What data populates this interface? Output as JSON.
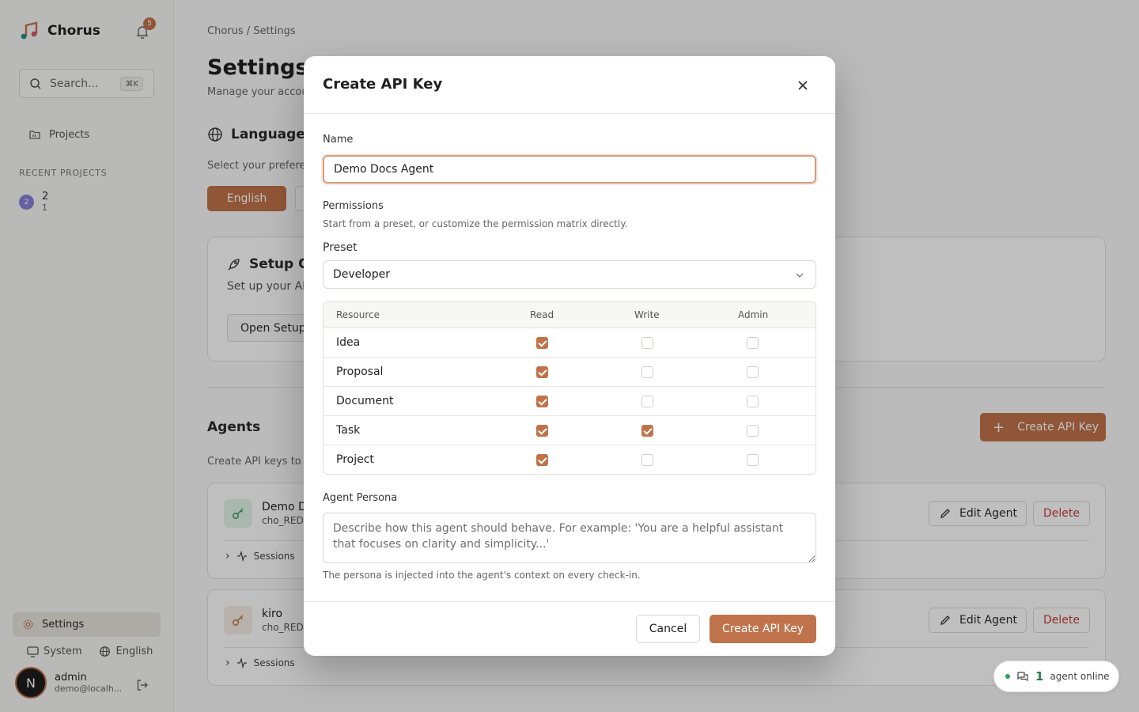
{
  "app": {
    "name": "Chorus",
    "notifications": "5"
  },
  "sidebar": {
    "search_placeholder": "Search...",
    "search_shortcut": "⌘K",
    "nav_projects": "Projects",
    "recent_title": "RECENT PROJECTS",
    "recent": [
      {
        "avatar": "2",
        "name": "2",
        "sub": "1"
      }
    ],
    "settings": "Settings",
    "theme": "System",
    "language": "English",
    "user": {
      "initial": "N",
      "name": "admin",
      "email": "demo@localh..."
    }
  },
  "page": {
    "breadcrumb": "Chorus / Settings",
    "title": "Settings",
    "subtitle": "Manage your accou",
    "language_title": "Language",
    "language_sub": "Select your prefere",
    "language_btn": "English",
    "setup_title": "Setup G",
    "setup_sub": "Set up your AI",
    "setup_btn": "Open Setup",
    "agents_title": "Agents",
    "agents_sub": "Create API keys to",
    "create_btn": "Create API Key",
    "agents": [
      {
        "name": "Demo D",
        "key": "cho_RED",
        "color": "#e3f4e8",
        "icon_color": "#3c9a5c"
      },
      {
        "name": "kiro",
        "key": "cho_RED",
        "color": "#f6ece6",
        "icon_color": "#c0734a"
      }
    ],
    "edit_label": "Edit Agent",
    "delete_label": "Delete",
    "sessions_label": "Sessions",
    "online_count": "1",
    "online_label": "agent online"
  },
  "modal": {
    "title": "Create API Key",
    "name_label": "Name",
    "name_value": "Demo Docs Agent",
    "permissions_label": "Permissions",
    "permissions_sub": "Start from a preset, or customize the permission matrix directly.",
    "preset_label": "Preset",
    "preset_value": "Developer",
    "columns": [
      "Resource",
      "Read",
      "Write",
      "Admin"
    ],
    "rows": [
      {
        "name": "Idea",
        "read": true,
        "write": false,
        "admin": false
      },
      {
        "name": "Proposal",
        "read": true,
        "write": false,
        "admin": false
      },
      {
        "name": "Document",
        "read": true,
        "write": false,
        "admin": false
      },
      {
        "name": "Task",
        "read": true,
        "write": true,
        "admin": false
      },
      {
        "name": "Project",
        "read": true,
        "write": false,
        "admin": false
      }
    ],
    "persona_label": "Agent Persona",
    "persona_placeholder": "Describe how this agent should behave. For example: 'You are a helpful assistant that focuses on clarity and simplicity...'",
    "persona_help": "The persona is injected into the agent's context on every check-in.",
    "cancel_label": "Cancel",
    "create_label": "Create API Key"
  },
  "colors": {
    "accent": "#c0734a"
  }
}
